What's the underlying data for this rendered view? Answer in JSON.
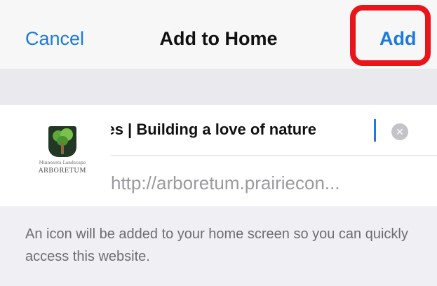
{
  "navbar": {
    "cancel_label": "Cancel",
    "title": "Add to Home",
    "add_label": "Add",
    "accent_color": "#1a7ae0",
    "highlight_color": "#e8151b"
  },
  "bookmark": {
    "icon_subtitle": "Minnesota Landscape",
    "icon_name": "ARBORETUM",
    "title_value": "n Guides | Building a love of nature",
    "url": "http://arboretum.prairiecon..."
  },
  "footer": {
    "description": "An icon will be added to your home screen so you can quickly access this website."
  }
}
